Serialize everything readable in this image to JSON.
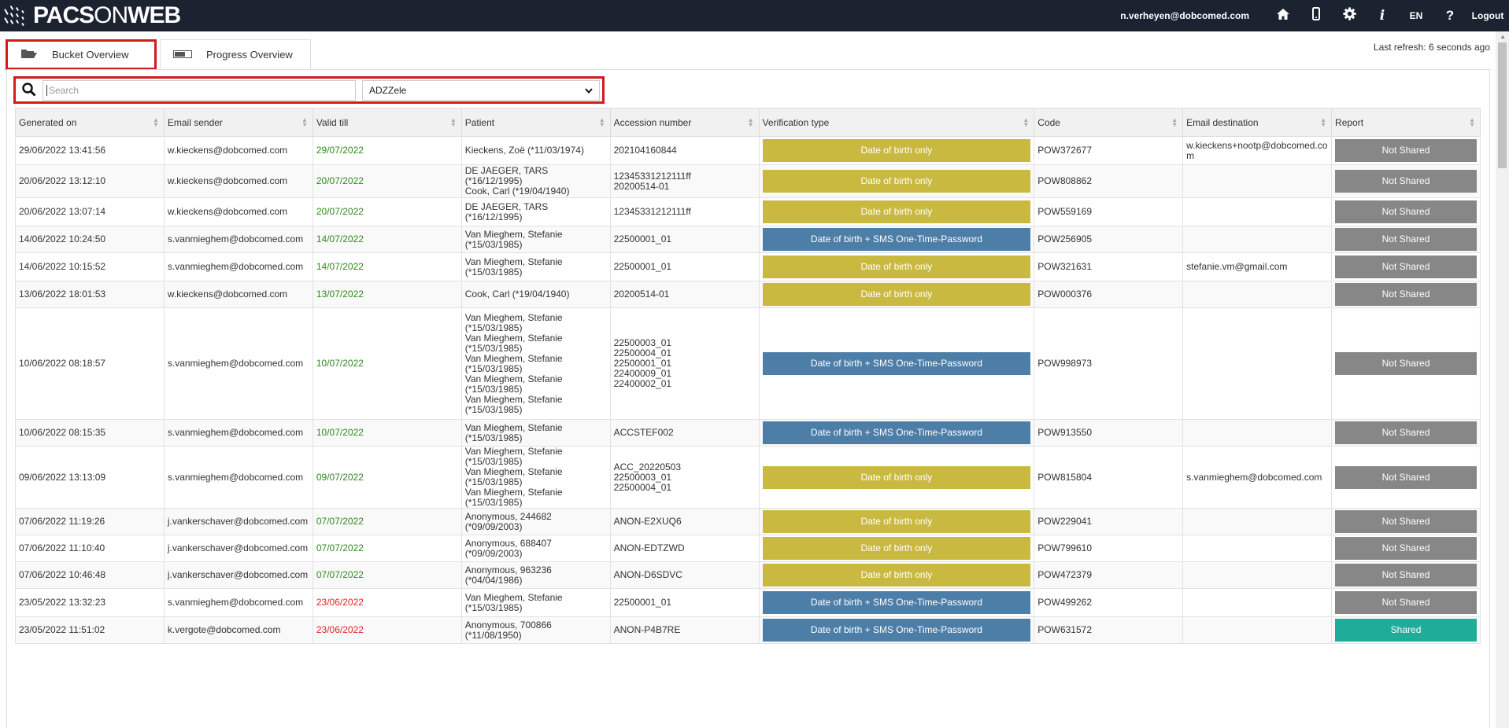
{
  "header": {
    "logo_left": "PACS",
    "logo_on": "ON",
    "logo_right": "WEB",
    "user_email": "n.verheyen@dobcomed.com",
    "language": "EN",
    "logout": "Logout",
    "icons": [
      "home-icon",
      "mobile-icon",
      "gear-icon",
      "info-icon",
      "help-icon"
    ]
  },
  "tabs": [
    {
      "label": "Bucket Overview",
      "icon": "folder-open-icon"
    },
    {
      "label": "Progress Overview",
      "icon": "progress-bar-icon"
    }
  ],
  "last_refresh": "Last refresh: 6 seconds ago",
  "search": {
    "placeholder": "Search",
    "selected_facility": "ADZZele"
  },
  "colors": {
    "top_bar": "#1b2230",
    "highlight": "#d21b1b",
    "dob_only": "#c9b940",
    "dob_sms": "#4d7ea8",
    "not_shared": "#878787",
    "shared": "#1fad9a",
    "valid_future": "#2f8a1d",
    "valid_past": "#e02424"
  },
  "table": {
    "columns": [
      "Generated on",
      "Email sender",
      "Valid till",
      "Patient",
      "Accession number",
      "Verification type",
      "Code",
      "Email destination",
      "Report"
    ],
    "rows": [
      {
        "generated": "29/06/2022 13:41:56",
        "sender": "w.kieckens@dobcomed.com",
        "valid": "29/07/2022",
        "valid_status": "green",
        "patient": "Kieckens, Zoë (*11/03/1974)",
        "accession": "202104160844",
        "verification": "Date of birth only",
        "verif_type": "yellow",
        "code": "POW372677",
        "dest": "w.kieckens+nootp@dobcomed.com",
        "report": "Not Shared",
        "report_type": "grey"
      },
      {
        "generated": "20/06/2022 13:12:10",
        "sender": "w.kieckens@dobcomed.com",
        "valid": "20/07/2022",
        "valid_status": "green",
        "patient": "DE JAEGER, TARS (*16/12/1995)\nCook, Carl (*19/04/1940)",
        "accession": "12345331212111ff\n20200514-01",
        "verification": "Date of birth only",
        "verif_type": "yellow",
        "code": "POW808862",
        "dest": "",
        "report": "Not Shared",
        "report_type": "grey"
      },
      {
        "generated": "20/06/2022 13:07:14",
        "sender": "w.kieckens@dobcomed.com",
        "valid": "20/07/2022",
        "valid_status": "green",
        "patient": "DE JAEGER, TARS (*16/12/1995)",
        "accession": "12345331212111ff",
        "verification": "Date of birth only",
        "verif_type": "yellow",
        "code": "POW559169",
        "dest": "",
        "report": "Not Shared",
        "report_type": "grey"
      },
      {
        "generated": "14/06/2022 10:24:50",
        "sender": "s.vanmieghem@dobcomed.com",
        "valid": "14/07/2022",
        "valid_status": "green",
        "patient": "Van Mieghem, Stefanie (*15/03/1985)",
        "accession": "22500001_01",
        "verification": "Date of birth + SMS One-Time-Password",
        "verif_type": "blue",
        "code": "POW256905",
        "dest": "",
        "report": "Not Shared",
        "report_type": "grey"
      },
      {
        "generated": "14/06/2022 10:15:52",
        "sender": "s.vanmieghem@dobcomed.com",
        "valid": "14/07/2022",
        "valid_status": "green",
        "patient": "Van Mieghem, Stefanie (*15/03/1985)",
        "accession": "22500001_01",
        "verification": "Date of birth only",
        "verif_type": "yellow",
        "code": "POW321631",
        "dest": "stefanie.vm@gmail.com",
        "report": "Not Shared",
        "report_type": "grey"
      },
      {
        "generated": "13/06/2022 18:01:53",
        "sender": "w.kieckens@dobcomed.com",
        "valid": "13/07/2022",
        "valid_status": "green",
        "patient": "Cook, Carl (*19/04/1940)",
        "accession": "20200514-01",
        "verification": "Date of birth only",
        "verif_type": "yellow",
        "code": "POW000376",
        "dest": "",
        "report": "Not Shared",
        "report_type": "grey"
      },
      {
        "generated": "10/06/2022 08:18:57",
        "sender": "s.vanmieghem@dobcomed.com",
        "valid": "10/07/2022",
        "valid_status": "green",
        "patient": "Van Mieghem, Stefanie (*15/03/1985)\nVan Mieghem, Stefanie (*15/03/1985)\nVan Mieghem, Stefanie (*15/03/1985)\nVan Mieghem, Stefanie (*15/03/1985)\nVan Mieghem, Stefanie (*15/03/1985)",
        "accession": "22500003_01\n22500004_01\n22500001_01\n22400009_01\n22400002_01",
        "verification": "Date of birth + SMS One-Time-Password",
        "verif_type": "blue",
        "code": "POW998973",
        "dest": "",
        "report": "Not Shared",
        "report_type": "grey"
      },
      {
        "generated": "10/06/2022 08:15:35",
        "sender": "s.vanmieghem@dobcomed.com",
        "valid": "10/07/2022",
        "valid_status": "green",
        "patient": "Van Mieghem, Stefanie (*15/03/1985)",
        "accession": "ACCSTEF002",
        "verification": "Date of birth + SMS One-Time-Password",
        "verif_type": "blue",
        "code": "POW913550",
        "dest": "",
        "report": "Not Shared",
        "report_type": "grey"
      },
      {
        "generated": "09/06/2022 13:13:09",
        "sender": "s.vanmieghem@dobcomed.com",
        "valid": "09/07/2022",
        "valid_status": "green",
        "patient": "Van Mieghem, Stefanie (*15/03/1985)\nVan Mieghem, Stefanie (*15/03/1985)\nVan Mieghem, Stefanie (*15/03/1985)",
        "accession": "ACC_20220503\n22500003_01\n22500004_01",
        "verification": "Date of birth only",
        "verif_type": "yellow",
        "code": "POW815804",
        "dest": "s.vanmieghem@dobcomed.com",
        "report": "Not Shared",
        "report_type": "grey"
      },
      {
        "generated": "07/06/2022 11:19:26",
        "sender": "j.vankerschaver@dobcomed.com",
        "valid": "07/07/2022",
        "valid_status": "green",
        "patient": "Anonymous, 244682 (*09/09/2003)",
        "accession": "ANON-E2XUQ6",
        "verification": "Date of birth only",
        "verif_type": "yellow",
        "code": "POW229041",
        "dest": "",
        "report": "Not Shared",
        "report_type": "grey"
      },
      {
        "generated": "07/06/2022 11:10:40",
        "sender": "j.vankerschaver@dobcomed.com",
        "valid": "07/07/2022",
        "valid_status": "green",
        "patient": "Anonymous, 688407 (*09/09/2003)",
        "accession": "ANON-EDTZWD",
        "verification": "Date of birth only",
        "verif_type": "yellow",
        "code": "POW799610",
        "dest": "",
        "report": "Not Shared",
        "report_type": "grey"
      },
      {
        "generated": "07/06/2022 10:46:48",
        "sender": "j.vankerschaver@dobcomed.com",
        "valid": "07/07/2022",
        "valid_status": "green",
        "patient": "Anonymous, 963236 (*04/04/1986)",
        "accession": "ANON-D6SDVC",
        "verification": "Date of birth only",
        "verif_type": "yellow",
        "code": "POW472379",
        "dest": "",
        "report": "Not Shared",
        "report_type": "grey"
      },
      {
        "generated": "23/05/2022 13:32:23",
        "sender": "s.vanmieghem@dobcomed.com",
        "valid": "23/06/2022",
        "valid_status": "red",
        "patient": "Van Mieghem, Stefanie (*15/03/1985)",
        "accession": "22500001_01",
        "verification": "Date of birth + SMS One-Time-Password",
        "verif_type": "blue",
        "code": "POW499262",
        "dest": "",
        "report": "Not Shared",
        "report_type": "grey"
      },
      {
        "generated": "23/05/2022 11:51:02",
        "sender": "k.vergote@dobcomed.com",
        "valid": "23/06/2022",
        "valid_status": "red",
        "patient": "Anonymous, 700866 (*11/08/1950)",
        "accession": "ANON-P4B7RE",
        "verification": "Date of birth + SMS One-Time-Password",
        "verif_type": "blue",
        "code": "POW631572",
        "dest": "",
        "report": "Shared",
        "report_type": "teal"
      }
    ]
  }
}
